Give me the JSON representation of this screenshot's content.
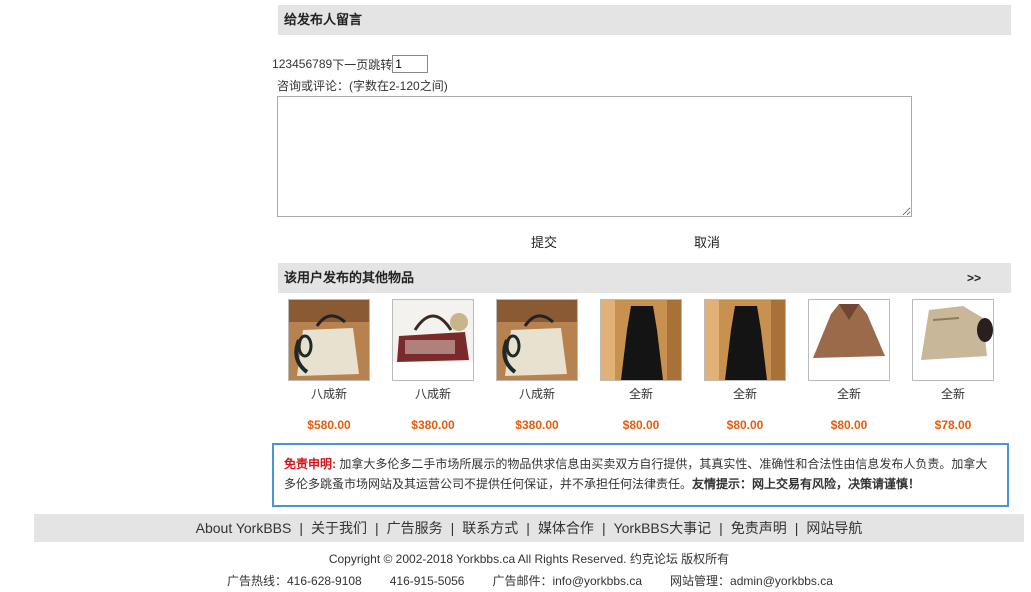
{
  "message_section": {
    "title": "给发布人留言",
    "pager": {
      "pages": [
        "1",
        "2",
        "3",
        "4",
        "5",
        "6",
        "7",
        "8",
        "9"
      ],
      "next_label": "下一页",
      "jump_label": "跳转",
      "jump_value": "1"
    },
    "comment_label": "咨询或评论：(字数在2-120之间)",
    "submit_label": "提交",
    "cancel_label": "取消"
  },
  "other_items": {
    "title": "该用户发布的其他物品",
    "more_label": ">>",
    "items": [
      {
        "condition": "八成新",
        "price": "$580.00",
        "thumb": "tote-bag"
      },
      {
        "condition": "八成新",
        "price": "$380.00",
        "thumb": "handbag"
      },
      {
        "condition": "八成新",
        "price": "$380.00",
        "thumb": "tote-bag"
      },
      {
        "condition": "全新",
        "price": "$80.00",
        "thumb": "black-dress"
      },
      {
        "condition": "全新",
        "price": "$80.00",
        "thumb": "black-dress"
      },
      {
        "condition": "全新",
        "price": "$80.00",
        "thumb": "cape"
      },
      {
        "condition": "全新",
        "price": "$78.00",
        "thumb": "coat"
      }
    ]
  },
  "disclaimer": {
    "title": "免责申明:",
    "body": " 加拿大多伦多二手市场所展示的物品供求信息由买卖双方自行提供，其真实性、准确性和合法性由信息发布人负责。加拿大多伦多跳蚤市场网站及其运营公司不提供任何保证，并不承担任何法律责任。",
    "tip": "友情提示：网上交易有风险，决策请谨慎！"
  },
  "footer": {
    "nav": [
      "About YorkBBS",
      "关于我们",
      "广告服务",
      "联系方式",
      "媒体合作",
      "YorkBBS大事记",
      "免责声明",
      "网站导航"
    ],
    "separator": "|",
    "copyright": "Copyright © 2002-2018 Yorkbbs.ca All Rights Reserved. 约克论坛 版权所有",
    "ad_hotline": "广告热线：416-628-9108",
    "ad_hotline2": "416-915-5056",
    "ad_email": "广告邮件：info@yorkbbs.ca",
    "admin_email": "网站管理：admin@yorkbbs.ca"
  },
  "colors": {
    "header_bg": "#e4e4e4",
    "price": "#e85a0c",
    "disclaimer_border": "#4b94d8",
    "disclaimer_title": "#d4151c"
  }
}
